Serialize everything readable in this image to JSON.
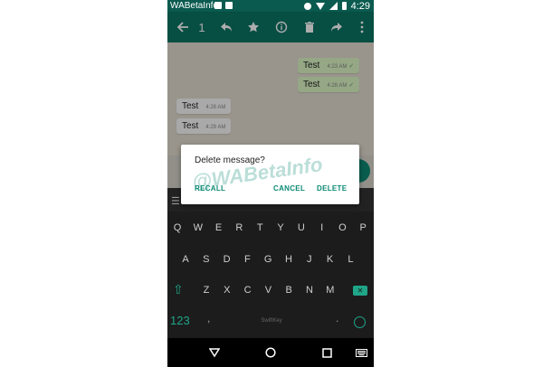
{
  "status_bar": {
    "app_label": "WABetaInfo",
    "time": "4:29"
  },
  "toolbar": {
    "selected_count": "1"
  },
  "messages": [
    {
      "direction": "out",
      "text": "Test",
      "time": "4:23 AM"
    },
    {
      "direction": "out",
      "text": "Test",
      "time": "4:28 AM"
    },
    {
      "direction": "in",
      "text": "Test",
      "time": "4:28 AM"
    },
    {
      "direction": "in",
      "text": "Test",
      "time": "4:29 AM"
    }
  ],
  "dialog": {
    "title": "Delete message?",
    "watermark": "@WABetaInfo",
    "recall_label": "RECALL",
    "cancel_label": "CANCEL",
    "delete_label": "DELETE"
  },
  "keyboard": {
    "row1": [
      "Q",
      "W",
      "E",
      "R",
      "T",
      "Y",
      "U",
      "I",
      "O",
      "P"
    ],
    "row2": [
      "A",
      "S",
      "D",
      "F",
      "G",
      "H",
      "J",
      "K",
      "L"
    ],
    "row3": [
      "Z",
      "X",
      "C",
      "V",
      "B",
      "N",
      "M"
    ],
    "numbers_label": "123",
    "comma": ",",
    "dot": ".",
    "space_brand": "SwiftKey"
  },
  "colors": {
    "toolbar": "#0b7464",
    "accent": "#0b8a74",
    "keyboard_accent": "#1fa588"
  }
}
